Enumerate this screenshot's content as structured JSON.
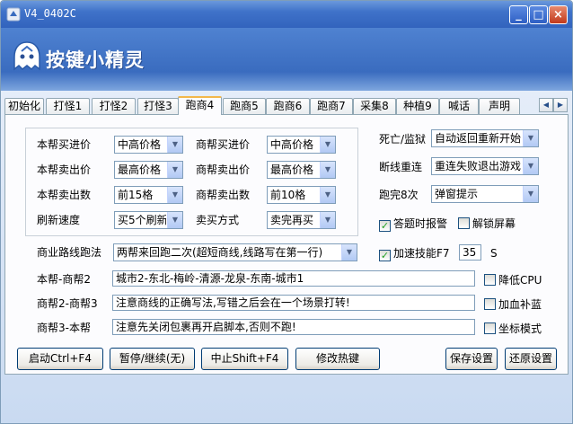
{
  "window": {
    "title": "V4_0402C"
  },
  "banner": {
    "logo_text": "按键小精灵"
  },
  "tabs": [
    {
      "label": "初始化"
    },
    {
      "label": "打怪1"
    },
    {
      "label": "打怪2"
    },
    {
      "label": "打怪3"
    },
    {
      "label": "跑商4"
    },
    {
      "label": "跑商5"
    },
    {
      "label": "跑商6"
    },
    {
      "label": "跑商7"
    },
    {
      "label": "采集8"
    },
    {
      "label": "种植9"
    },
    {
      "label": "喊话"
    },
    {
      "label": "声明"
    }
  ],
  "active_tab": "跑商4",
  "group": {
    "buy_price_label": "本帮买进价",
    "buy_price_value": "中高价格",
    "sell_price_label": "本帮卖出价",
    "sell_price_value": "最高价格",
    "sell_qty_label": "本帮卖出数",
    "sell_qty_value": "前15格",
    "refresh_label": "刷新速度",
    "refresh_value": "买5个刷新",
    "t_buy_price_label": "商帮买进价",
    "t_buy_price_value": "中高价格",
    "t_sell_price_label": "商帮卖出价",
    "t_sell_price_value": "最高价格",
    "t_sell_qty_label": "商帮卖出数",
    "t_sell_qty_value": "前10格",
    "sell_mode_label": "卖买方式",
    "sell_mode_value": "卖完再买"
  },
  "right": {
    "death_label": "死亡/监狱",
    "death_value": "自动返回重新开始",
    "reconnect_label": "断线重连",
    "reconnect_value": "重连失败退出游戏",
    "finish_label": "跑完8次",
    "finish_value": "弹窗提示",
    "answer_alarm": "答题时报警",
    "answer_alarm_checked": true,
    "unlock_screen": "解锁屏幕",
    "unlock_screen_checked": false,
    "speed_skill": "加速技能F7",
    "speed_skill_checked": true,
    "speed_value": "35",
    "speed_unit": "S",
    "low_cpu": "降低CPU",
    "low_cpu_checked": false,
    "add_blue": "加血补蓝",
    "add_blue_checked": false,
    "coord_mode": "坐标模式",
    "coord_mode_checked": false
  },
  "route": {
    "label": "商业路线跑法",
    "value": "两帮来回跑二次(超短商线,线路写在第一行)",
    "line1_label": "本帮-商帮2",
    "line1_value": "城市2-东北-梅岭-清源-龙泉-东南-城市1",
    "line2_label": "商帮2-商帮3",
    "line2_value": "注意商线的正确写法,写错之后会在一个场景打转!",
    "line3_label": "商帮3-本帮",
    "line3_value": "注意先关闭包裹再开启脚本,否则不跑!"
  },
  "buttons": {
    "start": "启动Ctrl+F4",
    "pause": "暂停/继续(无)",
    "stop": "中止Shift+F4",
    "hotkey": "修改热键",
    "save": "保存设置",
    "restore": "还原设置"
  }
}
